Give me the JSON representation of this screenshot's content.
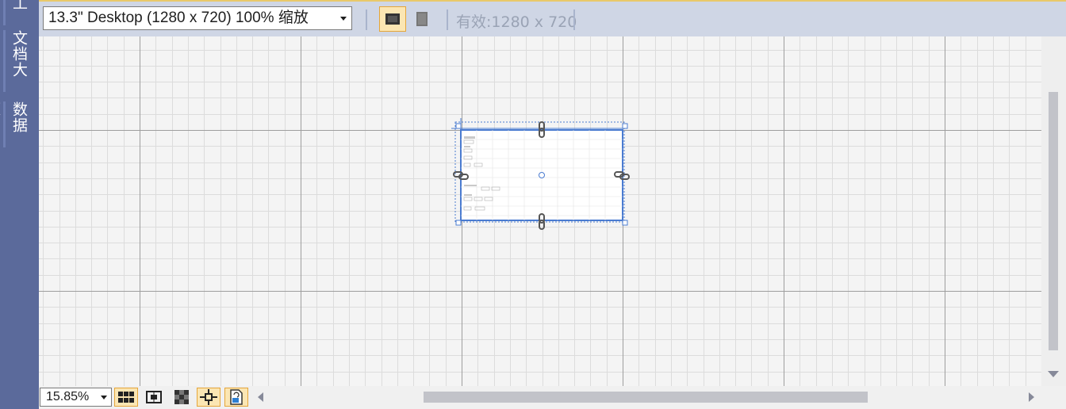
{
  "sidebar": {
    "tabs": [
      {
        "label": "工具箱"
      },
      {
        "label": "文档大纲"
      },
      {
        "label": "数据源"
      }
    ]
  },
  "toolbar": {
    "device_value": "13.3\" Desktop (1280 x 720) 100% 缩放",
    "landscape_label": "landscape-icon",
    "portrait_label": "portrait-icon",
    "effective_size": "有效:1280 x 720"
  },
  "bottom": {
    "zoom_value": "15.85%",
    "buttons": [
      "grid-icon",
      "snap-to-grid-icon",
      "checkerboard-icon",
      "snap-to-points-icon",
      "project-code-icon"
    ]
  },
  "colors": {
    "sidebar": "#5b6a9b",
    "toolbar": "#cfd6e5",
    "active_button": "#fbe6b3",
    "selection": "#4a7bd0"
  }
}
